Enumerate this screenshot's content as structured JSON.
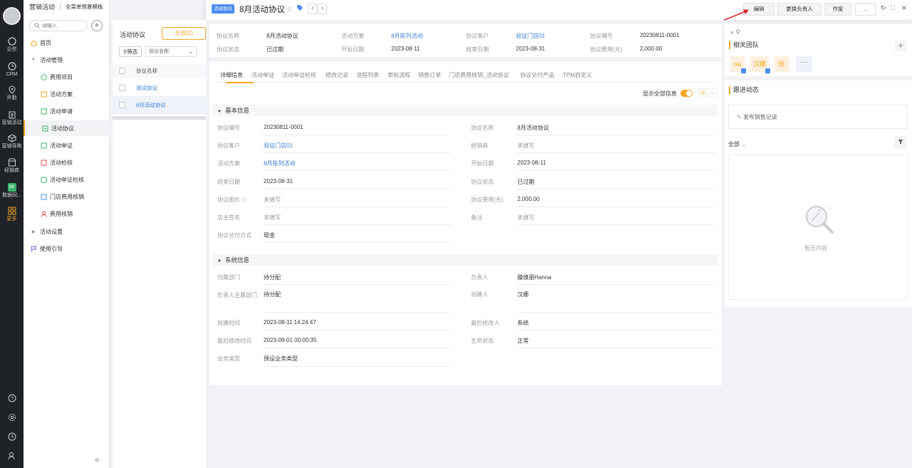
{
  "rail": {
    "items": [
      {
        "label": "企信",
        "icon": "chat-icon"
      },
      {
        "label": "CRM",
        "icon": "crm-icon"
      },
      {
        "label": "外勤",
        "icon": "location-icon"
      },
      {
        "label": "营销活动",
        "icon": "clipboard-icon"
      },
      {
        "label": "营销导购",
        "icon": "box-icon"
      },
      {
        "label": "经销商",
        "icon": "store-icon"
      },
      {
        "label": "数据同...",
        "icon": "data-sync-icon",
        "badge": "88"
      },
      {
        "label": "更多",
        "icon": "grid-icon"
      }
    ]
  },
  "nav": {
    "app_title": "营销活动",
    "template": "全菜单预置模板",
    "search_placeholder": "请输入",
    "items": [
      {
        "label": "首页",
        "level": 1,
        "icon": "home-icon"
      },
      {
        "label": "活动管理",
        "level": 1,
        "icon": "triangle-down-icon"
      },
      {
        "label": "费用项目",
        "level": 2,
        "icon": "coin-icon"
      },
      {
        "label": "活动方案",
        "level": 2,
        "icon": "plan-icon"
      },
      {
        "label": "活动申请",
        "level": 2,
        "icon": "apply-icon"
      },
      {
        "label": "活动协议",
        "level": 2,
        "icon": "agreement-icon",
        "active": true
      },
      {
        "label": "活动举证",
        "level": 2,
        "icon": "evidence-icon"
      },
      {
        "label": "活动检核",
        "level": 2,
        "icon": "check-icon"
      },
      {
        "label": "活动举证检核",
        "level": 2,
        "icon": "evidence-check-icon"
      },
      {
        "label": "门店费用核销",
        "level": 2,
        "icon": "store-writeoff-icon"
      },
      {
        "label": "费用核销",
        "level": 2,
        "icon": "writeoff-icon"
      },
      {
        "label": "活动设置",
        "level": 1,
        "icon": "triangle-right-icon"
      },
      {
        "label": "使用引导",
        "level": 1,
        "icon": "flag-icon"
      }
    ],
    "collapse": "«"
  },
  "list": {
    "title": "活动协议",
    "all_label": "全部(2)",
    "filter_label": "筛选",
    "field_select": "协议名称",
    "column_header": "协议名称",
    "rows": [
      "测试协议",
      "8月活动协议"
    ]
  },
  "header": {
    "tag": "活动协议",
    "title": "8月活动协议",
    "prev": "‹",
    "next": "›",
    "buttons": {
      "edit": "编辑",
      "change_owner": "更换负责人",
      "void": "作废",
      "more": "..."
    }
  },
  "summary": [
    {
      "label": "协议名称",
      "value": "8月活动协议",
      "link": false
    },
    {
      "label": "活动方案",
      "value": "8月陈列活动",
      "link": true
    },
    {
      "label": "协议客户",
      "value": "验证门店01",
      "link": true
    },
    {
      "label": "协议编号",
      "value": "20230811-0001",
      "link": false
    },
    {
      "label": "协议状态",
      "value": "已过期",
      "link": false
    },
    {
      "label": "开始日期",
      "value": "2023-08-11",
      "link": false
    },
    {
      "label": "结束日期",
      "value": "2023-08-31",
      "link": false
    },
    {
      "label": "协议费用(元)",
      "value": "2,000.00",
      "link": false
    }
  ],
  "tabs": [
    "详细信息",
    "活动举证",
    "活动举证检核",
    "修改记录",
    "流程列表",
    "审批流程",
    "销售订单",
    "门店费用核销_活动协议",
    "协议兑付产品",
    "TPM自定义"
  ],
  "show_all_label": "显示全部信息",
  "basic_section": {
    "title": "基本信息",
    "fields": [
      {
        "label": "协议编号",
        "value": "20230811-0001",
        "type": "text"
      },
      {
        "label": "协议名称",
        "value": "8月活动协议",
        "type": "text"
      },
      {
        "label": "协议客户",
        "value": "验证门店01",
        "type": "link"
      },
      {
        "label": "经销商",
        "value": "未填写",
        "type": "empty"
      },
      {
        "label": "活动方案",
        "value": "8月陈列活动",
        "type": "link"
      },
      {
        "label": "开始日期",
        "value": "2023-08-11",
        "type": "text"
      },
      {
        "label": "结束日期",
        "value": "2023-08-31",
        "type": "text"
      },
      {
        "label": "协议状态",
        "value": "已过期",
        "type": "text"
      },
      {
        "label": "协议图片",
        "value": "未填写",
        "type": "empty"
      },
      {
        "label": "协议费用(元)",
        "value": "2,000.00",
        "type": "text"
      },
      {
        "label": "店主签名",
        "value": "未填写",
        "type": "empty"
      },
      {
        "label": "备注",
        "value": "未填写",
        "type": "empty"
      },
      {
        "label": "协议兑付方式",
        "value": "现金",
        "type": "text"
      }
    ]
  },
  "system_section": {
    "title": "系统信息",
    "fields": [
      {
        "label": "归属部门",
        "value": "待分配"
      },
      {
        "label": "负责人",
        "value": "滕焕丽Hanna"
      },
      {
        "label": "负责人主属部门",
        "value": "待分配"
      },
      {
        "label": "创建人",
        "value": "汉娜"
      },
      {
        "label": "创建时间",
        "value": "2023-08-11 14:24:47"
      },
      {
        "label": "最后修改人",
        "value": "系统"
      },
      {
        "label": "最后修改时间",
        "value": "2023-09-01 00:00:35"
      },
      {
        "label": "生命状态",
        "value": "正常"
      },
      {
        "label": "业务类型",
        "value": "预设业务类型"
      }
    ]
  },
  "team": {
    "title": "相关团队",
    "members": [
      "na",
      "汉娜",
      "验"
    ],
    "more": "···"
  },
  "follow": {
    "title": "跟进动态",
    "post_label": "发布销售记录",
    "filter_label": "全部",
    "empty_label": "暂无内容"
  },
  "colors": {
    "accent": "#f5a623",
    "link": "#3a7bd5",
    "tag": "#4a8df0",
    "arrow": "#d9262a"
  }
}
